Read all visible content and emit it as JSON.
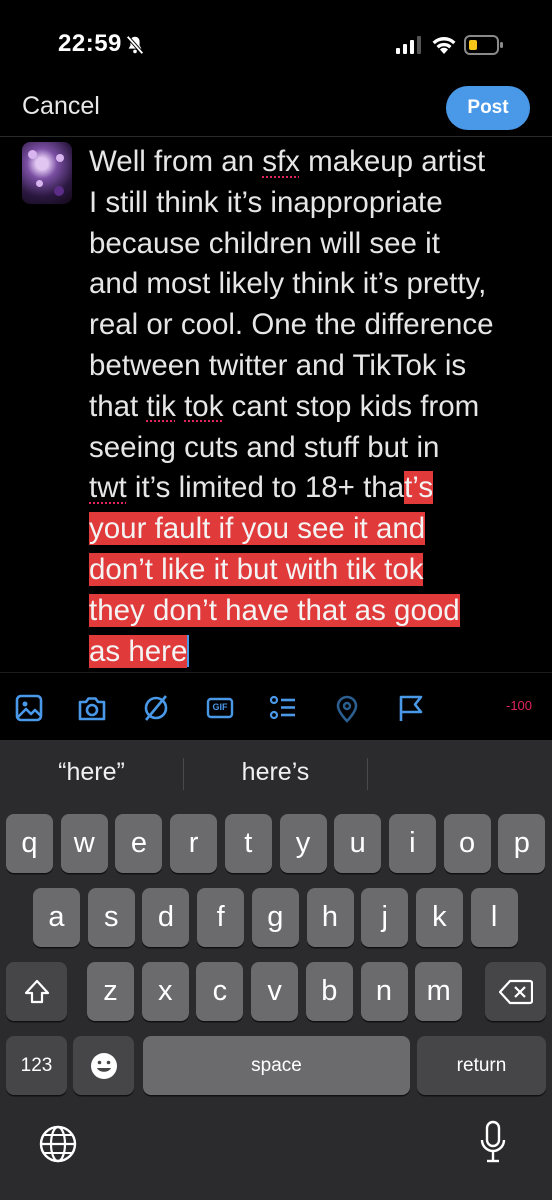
{
  "status": {
    "time": "22:59"
  },
  "header": {
    "cancel_label": "Cancel",
    "post_label": "Post"
  },
  "tweet": {
    "lines": [
      {
        "parts": [
          {
            "t": "Well from an "
          },
          {
            "t": "sfx",
            "spell": true
          },
          {
            "t": " makeup artist"
          }
        ]
      },
      {
        "parts": [
          {
            "t": "I still think it’s inappropriate"
          }
        ]
      },
      {
        "parts": [
          {
            "t": "because children will see it"
          }
        ]
      },
      {
        "parts": [
          {
            "t": "and most likely think it’s pretty,"
          }
        ]
      },
      {
        "parts": [
          {
            "t": "real or cool. One the difference"
          }
        ]
      },
      {
        "parts": [
          {
            "t": "between twitter and TikTok is"
          }
        ]
      },
      {
        "parts": [
          {
            "t": "that "
          },
          {
            "t": "tik",
            "spell": true
          },
          {
            "t": " "
          },
          {
            "t": "tok",
            "spell": true
          },
          {
            "t": " cant stop kids from"
          }
        ]
      },
      {
        "parts": [
          {
            "t": "seeing cuts and stuff but in"
          }
        ]
      },
      {
        "parts": [
          {
            "t": "twt",
            "spell": true
          },
          {
            "t": " it’s limited to 18+ tha"
          },
          {
            "t": "t’s",
            "hl": true
          }
        ]
      },
      {
        "parts": [
          {
            "t": "your fault if you see it and",
            "hl": true
          }
        ]
      },
      {
        "parts": [
          {
            "t": "don’t like it but with tik tok",
            "hl": true
          }
        ]
      },
      {
        "parts": [
          {
            "t": "they don’t have that as good",
            "hl": true
          }
        ]
      },
      {
        "parts": [
          {
            "t": "as here",
            "hl": true
          },
          {
            "caret": true
          }
        ]
      }
    ]
  },
  "toolbar": {
    "icons": [
      "image-icon",
      "camera-icon",
      "no-filter-icon",
      "gif-icon",
      "list-icon",
      "location-pin-icon",
      "flag-icon"
    ],
    "gif_label": "GIF",
    "char_count": "-100",
    "accent": "#4a99e9",
    "warning_color": "#e0245e"
  },
  "keyboard": {
    "suggestions": [
      "“here”",
      "here’s",
      ""
    ],
    "row1": [
      "q",
      "w",
      "e",
      "r",
      "t",
      "y",
      "u",
      "i",
      "o",
      "p"
    ],
    "row2": [
      "a",
      "s",
      "d",
      "f",
      "g",
      "h",
      "j",
      "k",
      "l"
    ],
    "row3": [
      "z",
      "x",
      "c",
      "v",
      "b",
      "n",
      "m"
    ],
    "numbers_label": "123",
    "space_label": "space",
    "return_label": "return"
  }
}
